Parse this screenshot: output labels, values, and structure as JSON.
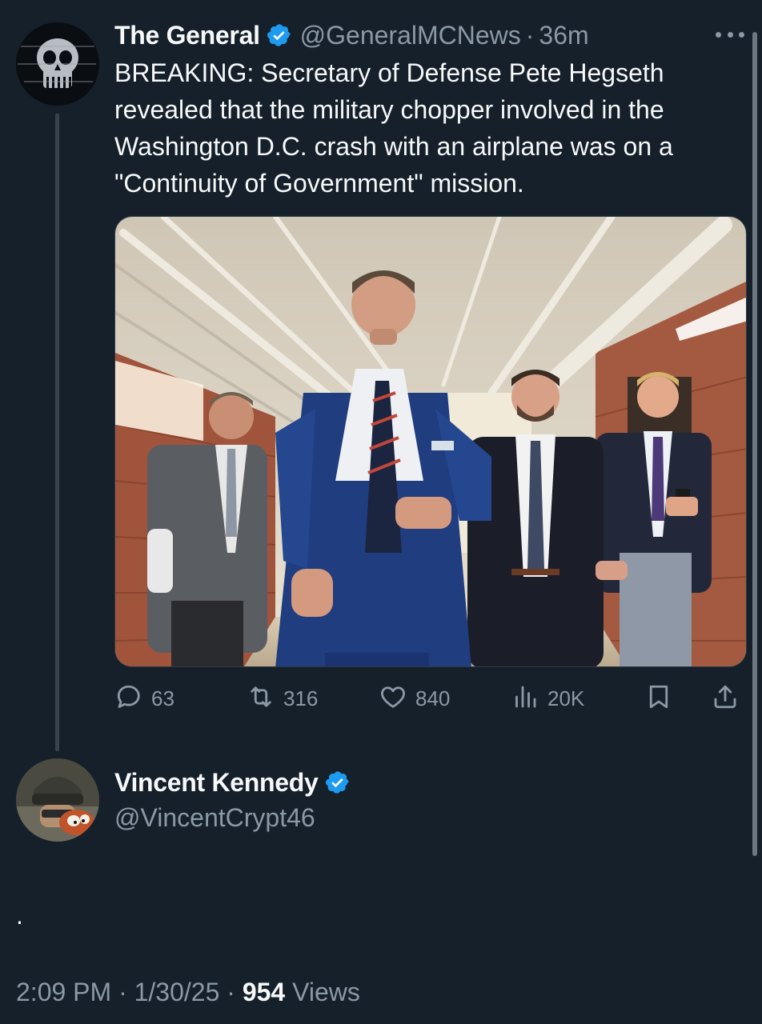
{
  "parent_tweet": {
    "display_name": "The General",
    "handle": "@GeneralMCNews",
    "separator": "·",
    "time_ago": "36m",
    "text_lines": [
      "BREAKING: Secretary of Defense Pete Hegseth",
      "revealed that the military chopper involved in the",
      "Washington D.C. crash with an airplane was on a",
      "\"Continuity of Government\" mission."
    ],
    "media_icon": "photo-of-men-in-suits-walking-in-hallway",
    "actions": {
      "replies": "63",
      "reposts": "316",
      "likes": "840",
      "views": "20K"
    }
  },
  "reply_tweet": {
    "display_name": "Vincent Kennedy",
    "handle": "@VincentCrypt46",
    "text": ".",
    "time": "2:09 PM",
    "sep1": "·",
    "date": "1/30/25",
    "sep2": "·",
    "views_count": "954",
    "views_label": "Views"
  },
  "colors": {
    "background": "#15202b",
    "primary_text": "#f7f9f9",
    "secondary_text": "#8b98a5",
    "verified_blue": "#1d9bf0",
    "thread_line": "#38444d"
  },
  "icons": [
    "verified-badge-icon",
    "more-icon",
    "reply-icon",
    "repost-icon",
    "like-icon",
    "views-icon",
    "bookmark-icon",
    "share-icon"
  ]
}
